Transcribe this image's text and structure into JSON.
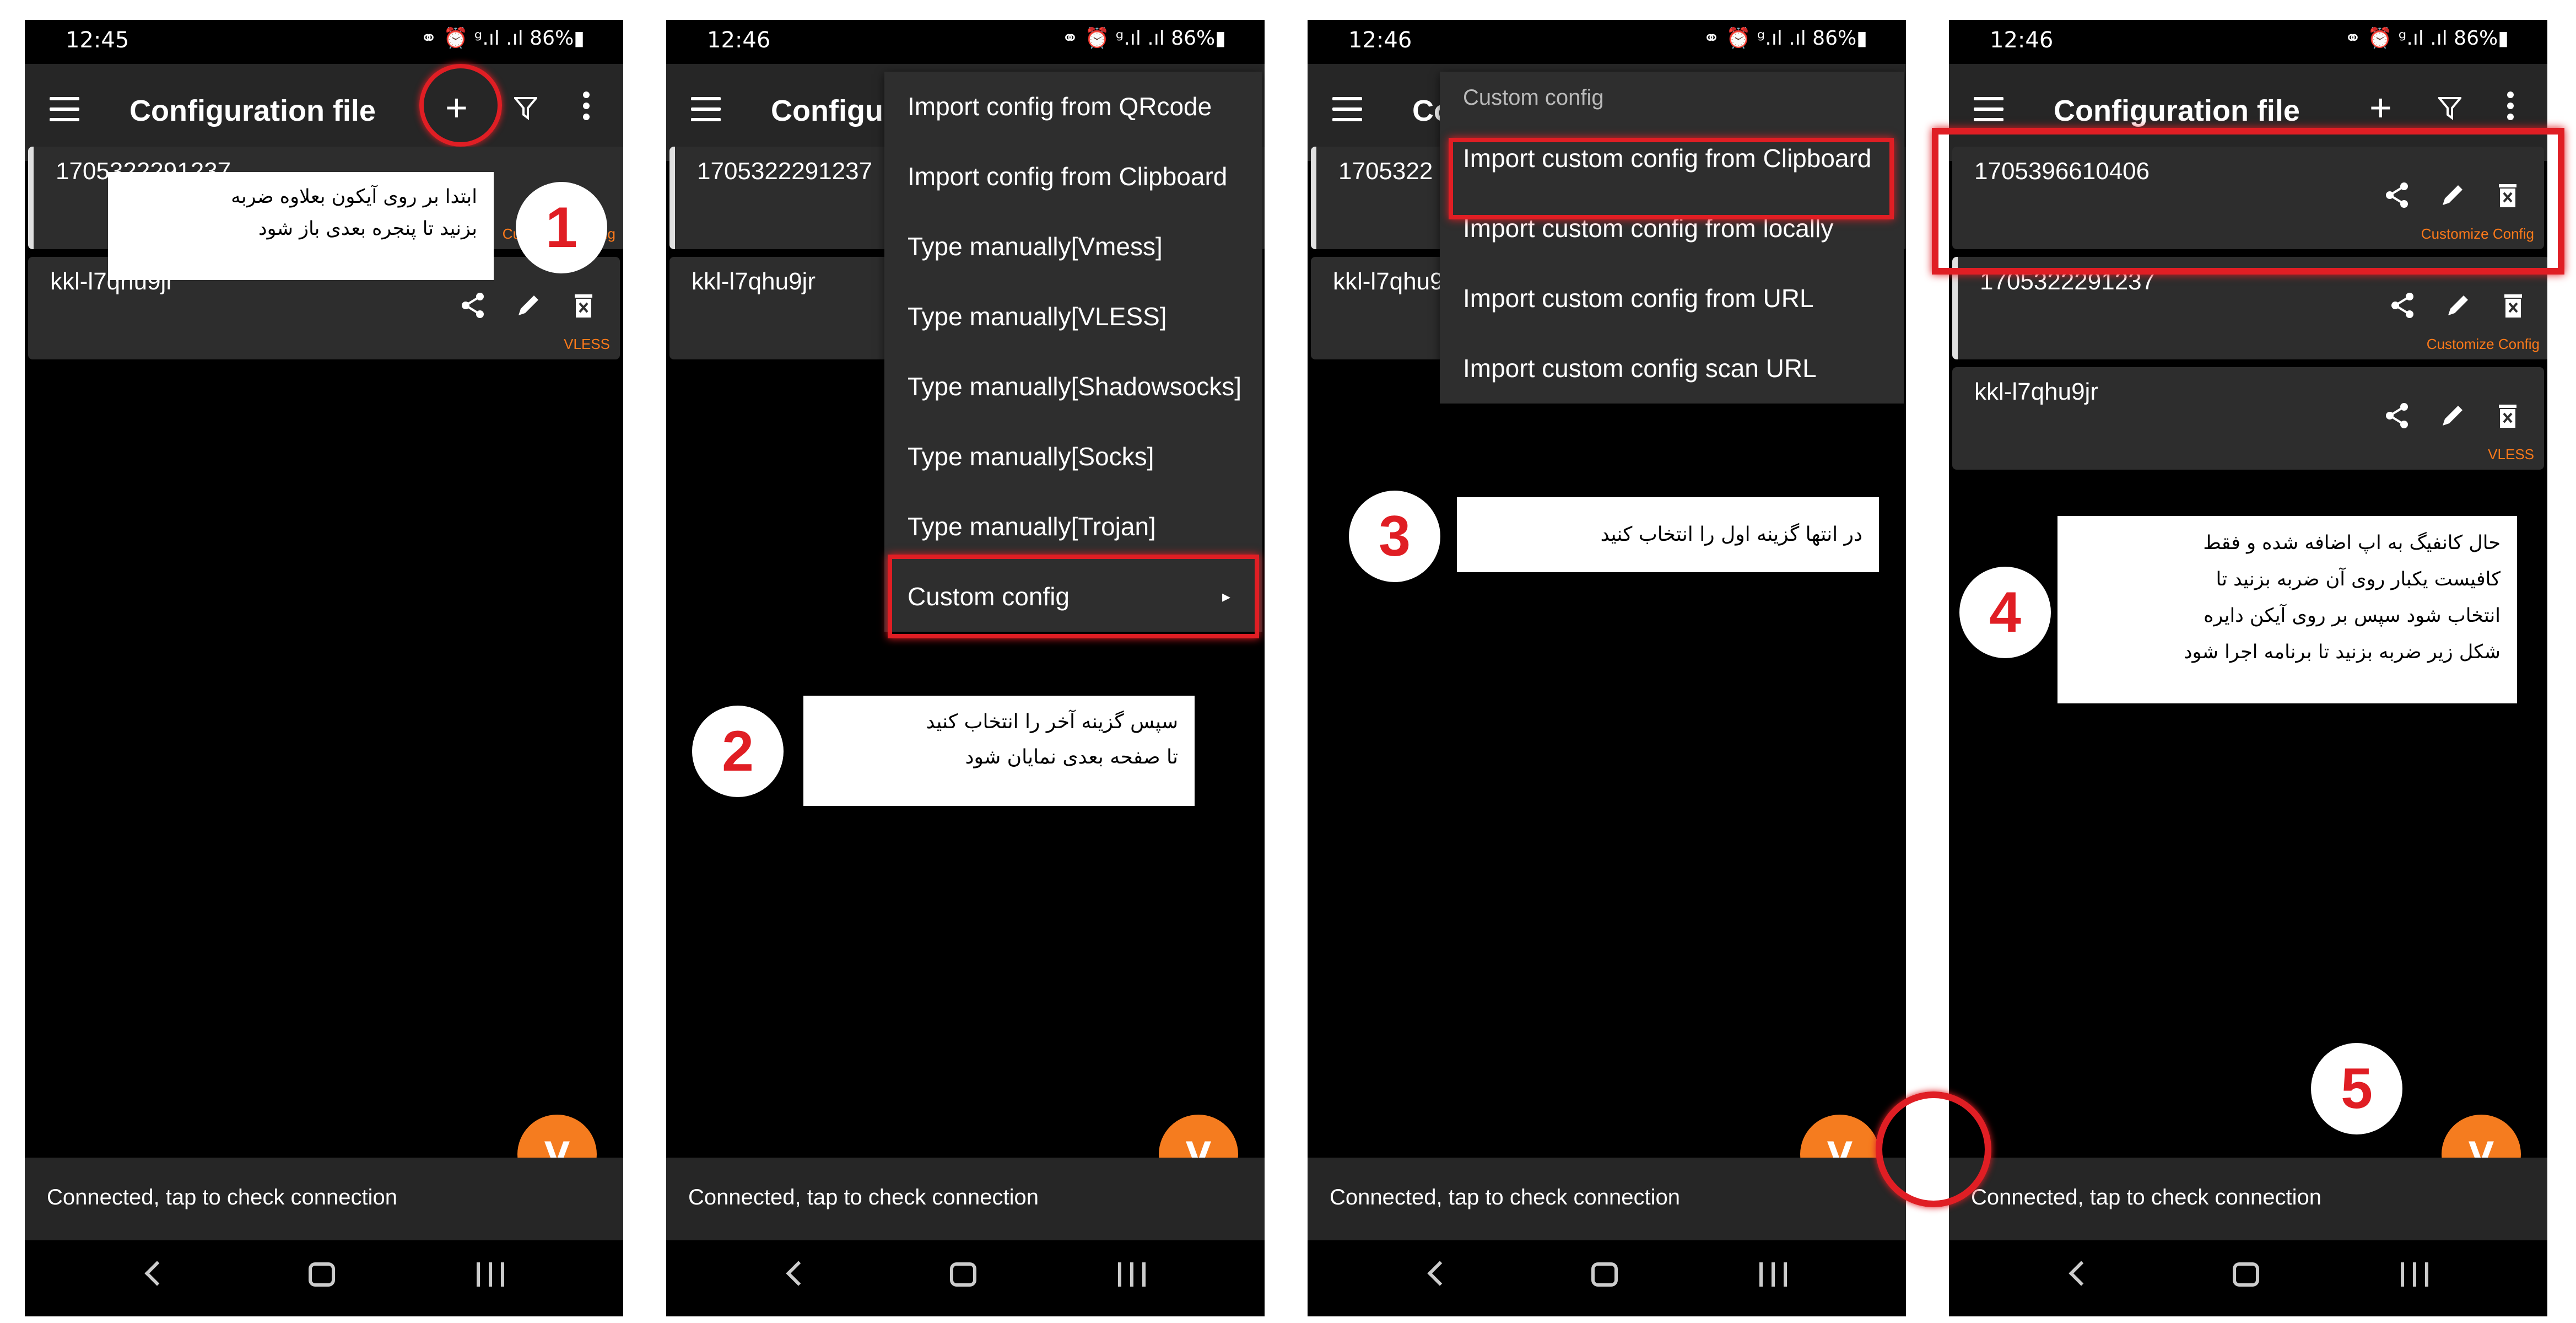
{
  "status": {
    "icons": "⚭ ⏰ ᵍ.ıl .ıl 86%▮",
    "time_1": "12:45",
    "time_2": "12:46",
    "time_3": "12:46",
    "time_4": "12:46"
  },
  "toolbar": {
    "title": "Configuration file",
    "title_short_2": "Configur",
    "title_short_3": "Co",
    "plus_icon": "+"
  },
  "panel1": {
    "cards": [
      {
        "name": "1705322291237",
        "type": "Customize Config"
      },
      {
        "name": "kkl-l7qhu9jr",
        "type": "VLESS"
      }
    ]
  },
  "panel2": {
    "cards": [
      {
        "name": "1705322291237"
      },
      {
        "name": "kkl-l7qhu9jr"
      }
    ],
    "menu": [
      "Import config from QRcode",
      "Import config from Clipboard",
      "Type manually[Vmess]",
      "Type manually[VLESS]",
      "Type manually[Shadowsocks]",
      "Type manually[Socks]",
      "Type manually[Trojan]",
      "Custom config"
    ],
    "submenu_arrow": "▸"
  },
  "panel3": {
    "cards": [
      {
        "name": "1705322"
      },
      {
        "name": "kkl-l7qhu9"
      }
    ],
    "menu_header": "Custom config",
    "menu": [
      "Import custom config from Clipboard",
      "Import custom config from locally",
      "Import custom config from URL",
      "Import custom config scan URL"
    ]
  },
  "panel4": {
    "cards": [
      {
        "name": "1705396610406",
        "type": "Customize Config"
      },
      {
        "name": "1705322291237",
        "type": "Customize Config"
      },
      {
        "name": "kkl-l7qhu9jr",
        "type": "VLESS"
      }
    ]
  },
  "fab_label": "V",
  "bottom_status": "Connected, tap to check connection",
  "notes": {
    "n1_l1": "ابتدا بر روی آیکون بعلاوه ضربه",
    "n1_l2": "بزنید تا پنجره بعدی باز شود",
    "n2_l1": "سپس گزینه آخر را انتخاب کنید",
    "n2_l2": "تا صفحه بعدی نمایان شود",
    "n3": "در انتها گزینه اول را انتخاب کنید",
    "n4_l1": "حال کانفیگ به اپ اضافه شده و فقط",
    "n4_l2": "کافیست یکبار روی آن ضربه بزنید تا",
    "n4_l3": "انتخاب شود سپس بر روی آیکن دایره",
    "n4_l4": "شکل زیر ضربه بزنید تا برنامه اجرا شود"
  },
  "steps": [
    "1",
    "2",
    "3",
    "4",
    "5"
  ],
  "colors": {
    "accent": "#f57c1f",
    "highlight": "#e01e24",
    "type_label": "#ff7a1a"
  }
}
